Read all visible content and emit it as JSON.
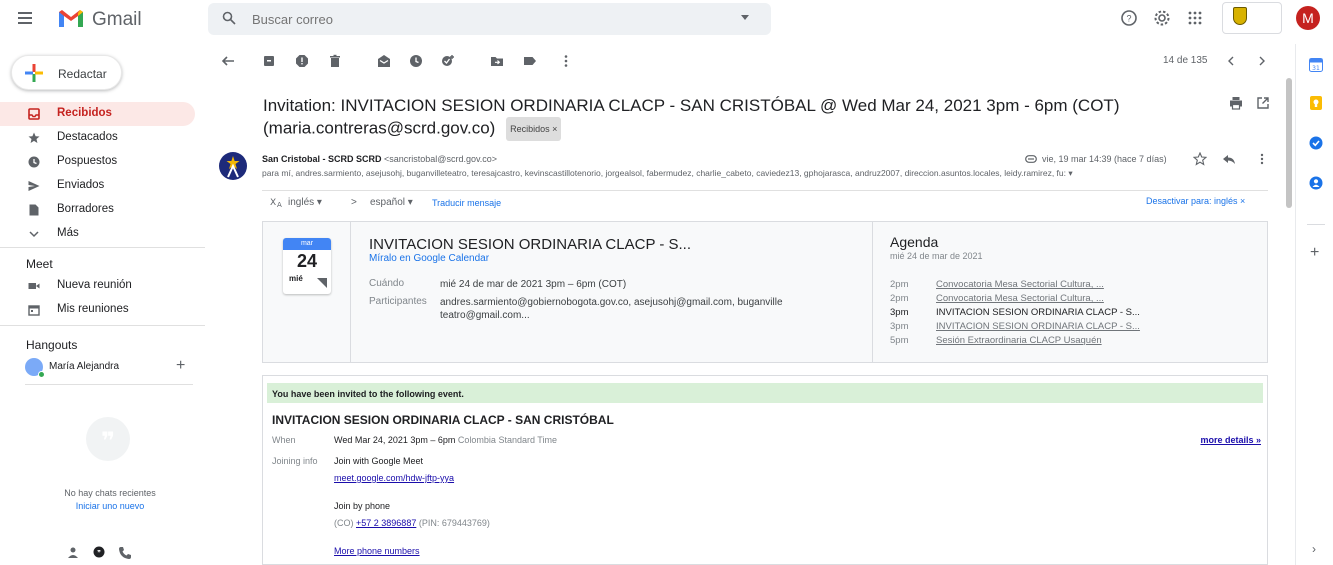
{
  "app": {
    "name": "Gmail"
  },
  "search": {
    "placeholder": "Buscar correo"
  },
  "sidebar": {
    "compose_label": "Redactar",
    "items": [
      {
        "label": "Recibidos",
        "icon": "inbox-icon",
        "active": true
      },
      {
        "label": "Destacados",
        "icon": "star-icon"
      },
      {
        "label": "Pospuestos",
        "icon": "clock-icon"
      },
      {
        "label": "Enviados",
        "icon": "send-icon"
      },
      {
        "label": "Borradores",
        "icon": "draft-icon"
      },
      {
        "label": "Más",
        "icon": "chevron-down-icon"
      }
    ],
    "meet_title": "Meet",
    "meet_items": [
      {
        "label": "Nueva reunión",
        "icon": "video-icon"
      },
      {
        "label": "Mis reuniones",
        "icon": "calendar-icon"
      }
    ],
    "hangouts_title": "Hangouts",
    "hangouts_user": "María Alejandra",
    "no_chats": "No hay chats recientes",
    "start_new": "Iniciar uno nuevo"
  },
  "user": {
    "avatar_letter": "M",
    "avatar_color": "#c5221f"
  },
  "toolbar": {
    "counter": "14 de 135"
  },
  "email": {
    "subject": "Invitation: INVITACION SESION ORDINARIA CLACP - SAN CRISTÓBAL @ Wed Mar 24, 2021 3pm - 6pm (COT) (maria.contreras@scrd.gov.co)",
    "label_chip": "Recibidos ×",
    "sender_name": "San Cristobal - SCRD SCRD",
    "sender_email": "<sancristobal@scrd.gov.co>",
    "recipients": "para mí, andres.sarmiento, asejusohj, buganvilleteatro, teresajcastro, kevinscastillotenorio, jorgealsol, fabermudez, charlie_cabeto, caviedez13, gphojarasca, andruz2007, direccion.asuntos.locales, leidy.ramirez, fu: ▾",
    "date": "vie, 19 mar 14:39 (hace 7 días)"
  },
  "translate": {
    "from_lang": "inglés ▾",
    "arrow": ">",
    "to_lang": "español ▾",
    "translate_link": "Traducir mensaje",
    "disable_link": "Desactivar para: inglés ×"
  },
  "calendar_card": {
    "month": "mar",
    "day": "24",
    "weekday": "mié",
    "event_title": "INVITACION SESION ORDINARIA CLACP - S...",
    "view_link": "Míralo en Google Calendar",
    "when_label": "Cuándo",
    "when_value": "mié 24 de mar de 2021 3pm – 6pm (COT)",
    "participants_label": "Participantes",
    "participants_value": "andres.sarmiento@gobiernobogota.gov.co, asejusohj@gmail.com, buganville teatro@gmail.com...",
    "agenda_title": "Agenda",
    "agenda_date": "mié 24 de mar de 2021",
    "agenda": [
      {
        "time": "2pm",
        "name": "Convocatoria Mesa Sectorial Cultura, ..."
      },
      {
        "time": "2pm",
        "name": "Convocatoria Mesa Sectorial Cultura, ..."
      },
      {
        "time": "3pm",
        "name": "INVITACION SESION ORDINARIA CLACP - S...",
        "current": true
      },
      {
        "time": "3pm",
        "name": "INVITACION SESION ORDINARIA CLACP - S..."
      },
      {
        "time": "5pm",
        "name": "Sesión Extraordinaria CLACP Usaquén"
      }
    ]
  },
  "invite": {
    "banner": "You have been invited to the following event.",
    "title": "INVITACION SESION ORDINARIA CLACP - SAN CRISTÓBAL",
    "when_label": "When",
    "when_value": "Wed Mar 24, 2021 3pm – 6pm",
    "when_tz": "Colombia Standard Time",
    "more_details": "more details »",
    "joining_label": "Joining info",
    "join_meet": "Join with Google Meet",
    "meet_link": "meet.google.com/hdw-jftp-yya",
    "join_phone": "Join by phone",
    "phone_prefix": "(CO)",
    "phone_number": "+57 2 3896887",
    "phone_pin": "(PIN: 679443769)",
    "more_phones": "More phone numbers"
  }
}
